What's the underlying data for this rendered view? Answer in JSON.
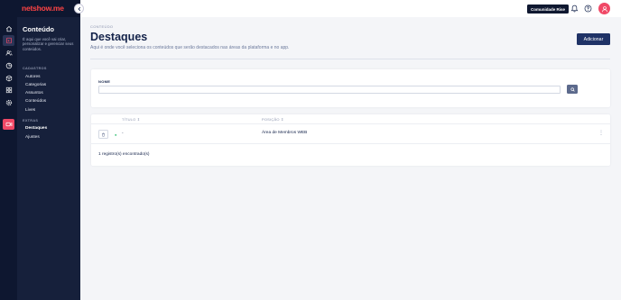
{
  "brand": {
    "logo_text": "netshow.me"
  },
  "topbar": {
    "community_label": "Comunidade Rise",
    "icons": [
      "bell-icon",
      "help-icon",
      "user-icon"
    ]
  },
  "rail": {
    "icons": [
      "home-icon",
      "content-icon",
      "users-icon",
      "analytics-icon",
      "package-icon",
      "apps-icon",
      "settings-icon",
      "video-icon"
    ],
    "active": "content-icon",
    "accent": "#f04866"
  },
  "sidebar": {
    "title": "Conteúdo",
    "description": "É aqui que você vai criar, personalizar e gerenciar seus conteúdos.",
    "sections": [
      {
        "label": "CADASTROS",
        "items": [
          "Autores",
          "Categorias",
          "Assuntos",
          "Conteúdos",
          "Lives"
        ]
      },
      {
        "label": "EXTRAS",
        "items": [
          "Destaques",
          "Ajustes"
        ]
      }
    ],
    "current": "Destaques"
  },
  "main": {
    "breadcrumb": "CONTEÚDO",
    "title": "Destaques",
    "subtitle": "Aqui é onde você seleciona os conteúdos que serão destacados nas áreas da plataforma e no app.",
    "add_button": "Adicionar"
  },
  "filter": {
    "name_label": "NOME",
    "name_value": "",
    "name_placeholder": ""
  },
  "table": {
    "columns": [
      "TÍTULO ⇕",
      "POSIÇÃO ⇕"
    ],
    "rows": [
      {
        "title": "-",
        "position": "Área de Membros WEB",
        "status": "active"
      }
    ],
    "count_text": "1 registro(s) encontrado(s)"
  },
  "colors": {
    "navy": "#0e1730",
    "panel": "#16203b",
    "primary": "#1f3266",
    "status_active": "#2fbf71"
  }
}
